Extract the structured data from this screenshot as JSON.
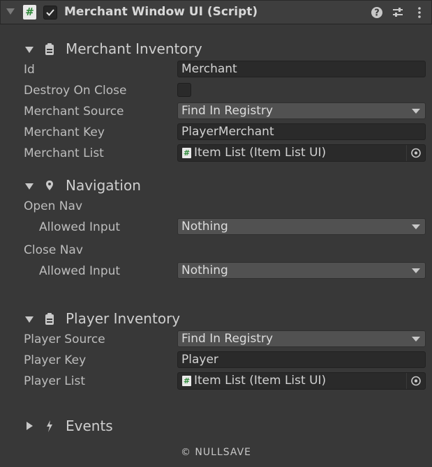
{
  "header": {
    "title": "Merchant Window UI (Script)",
    "script_icon": "#",
    "enabled": true,
    "icons": [
      "help-icon",
      "presets-icon",
      "kebab-menu-icon"
    ]
  },
  "sections": {
    "merchant_inventory": {
      "title": "Merchant Inventory",
      "expanded": true,
      "icon": "inventory-icon",
      "fields": {
        "id_label": "Id",
        "id_value": "Merchant",
        "destroy_label": "Destroy On Close",
        "destroy_checked": false,
        "source_label": "Merchant Source",
        "source_value": "Find In Registry",
        "key_label": "Merchant Key",
        "key_value": "PlayerMerchant",
        "list_label": "Merchant List",
        "list_value": "Item List (Item List UI)"
      }
    },
    "navigation": {
      "title": "Navigation",
      "expanded": true,
      "icon": "location-pin-icon",
      "open_nav_label": "Open Nav",
      "open_allowed_label": "Allowed Input",
      "open_allowed_value": "Nothing",
      "close_nav_label": "Close Nav",
      "close_allowed_label": "Allowed Input",
      "close_allowed_value": "Nothing"
    },
    "player_inventory": {
      "title": "Player Inventory",
      "expanded": true,
      "icon": "inventory-icon",
      "fields": {
        "source_label": "Player Source",
        "source_value": "Find In Registry",
        "key_label": "Player Key",
        "key_value": "Player",
        "list_label": "Player List",
        "list_value": "Item List (Item List UI)"
      }
    },
    "events": {
      "title": "Events",
      "expanded": false,
      "icon": "lightning-icon"
    }
  },
  "footer": {
    "text": "© NULLSAVE"
  },
  "colors": {
    "panel_bg": "#383838",
    "header_bg": "#3e3e3e",
    "field_bg": "#2a2a2a",
    "dropdown_bg": "#515151",
    "script_icon_green": "#2f8a3a"
  }
}
